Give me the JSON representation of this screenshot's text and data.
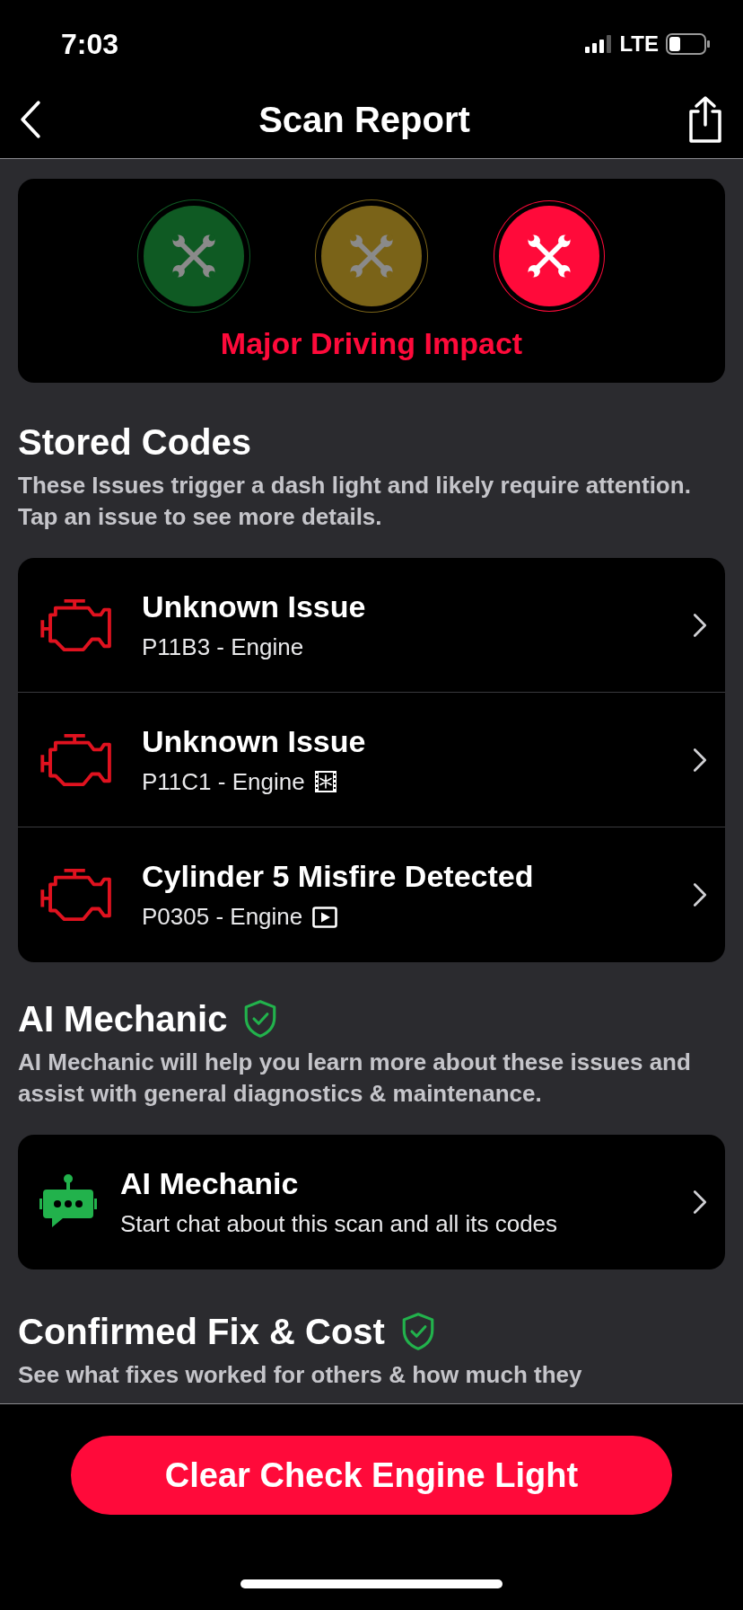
{
  "status_bar": {
    "time": "7:03",
    "network": "LTE"
  },
  "nav": {
    "title": "Scan Report"
  },
  "impact": {
    "levels": [
      {
        "color": "#0f5a23",
        "selected": false
      },
      {
        "color": "#7a6318",
        "selected": false
      },
      {
        "color": "#ff0a3a",
        "selected": true
      }
    ],
    "label": "Major Driving Impact"
  },
  "stored_codes": {
    "title": "Stored Codes",
    "description": "These Issues trigger a dash light and likely require attention. Tap an issue to see more details.",
    "items": [
      {
        "title": "Unknown Issue",
        "code": "P11B3 - Engine",
        "kind": "plain"
      },
      {
        "title": "Unknown Issue",
        "code": "P11C1 - Engine",
        "kind": "freeze_frame"
      },
      {
        "title": "Cylinder 5 Misfire Detected",
        "code": "P0305 - Engine",
        "kind": "video"
      }
    ]
  },
  "ai_mechanic": {
    "title": "AI Mechanic",
    "description": "AI Mechanic will help you learn more about these issues and assist with general diagnostics & maintenance.",
    "card": {
      "title": "AI Mechanic",
      "subtitle": "Start chat about this scan and all its codes"
    }
  },
  "confirmed_fix": {
    "title": "Confirmed Fix & Cost",
    "description": "See what fixes worked for others & how much they"
  },
  "clear_button": {
    "label": "Clear Check Engine Light"
  }
}
